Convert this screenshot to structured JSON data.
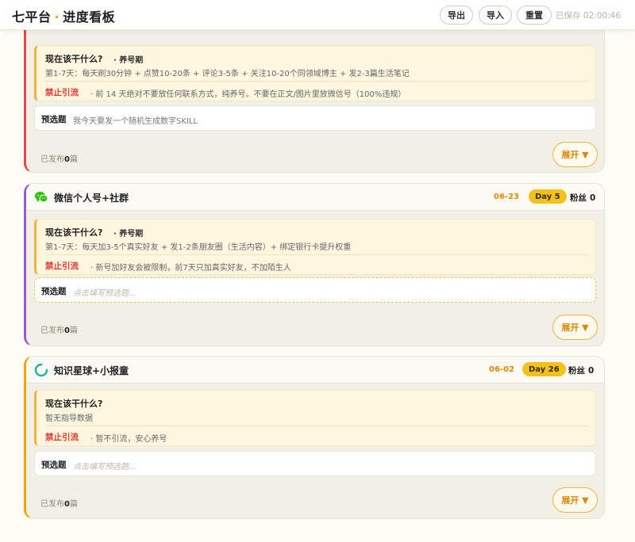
{
  "header": {
    "brand_left": "七平台",
    "brand_dot": "·",
    "brand_right": "进度看板",
    "export_label": "导出",
    "import_label": "导入",
    "reset_label": "重置",
    "saved_text": "已保存 02:00:46"
  },
  "cards": [
    {
      "accent": "#e8454f",
      "todo_question": "现在该干什么?",
      "phase": "· 养号期",
      "plan": "第1-7天：每天刷30分钟 + 点赞10-20条 + 评论3-5条 + 关注10-20个同领域博主 + 发2-3篇生活笔记",
      "ban_label": "禁止引流",
      "ban_text": "· 前 14 天绝对不要放任何联系方式，纯养号。不要在正文/图片里放微信号（100%违规）",
      "topic_label": "预选题",
      "topic_value": "我今天要发一个随机生成数字SKILL",
      "published_prefix": "已发布",
      "published_count": "0",
      "published_suffix": "篇",
      "expand_label": "展开 ▼"
    },
    {
      "accent": "#9b59d0",
      "platform_name": "微信个人号+社群",
      "platform_icon": "wechat-icon",
      "date": "06-23",
      "day": "Day 5",
      "fans_label": "粉丝",
      "fans_value": "0",
      "todo_question": "现在该干什么?",
      "phase": "· 养号期",
      "plan": "第1-7天：每天加3-5个真实好友 + 发1-2条朋友圈（生活内容）+ 绑定银行卡提升权重",
      "ban_label": "禁止引流",
      "ban_text": "· 新号加好友会被限制，前7天只加真实好友，不加陌生人",
      "topic_label": "预选题",
      "topic_placeholder": "点击填写预选题...",
      "published_prefix": "已发布",
      "published_count": "0",
      "published_suffix": "篇",
      "expand_label": "展开 ▼"
    },
    {
      "accent": "#f0a500",
      "platform_name": "知识星球+小报童",
      "platform_icon": "zsxq-icon",
      "date": "06-02",
      "day": "Day 26",
      "fans_label": "粉丝",
      "fans_value": "0",
      "todo_question": "现在该干什么?",
      "plan": "暂无指导数据",
      "ban_label": "禁止引流",
      "ban_text": "· 暂不引流，安心养号",
      "topic_label": "预选题",
      "topic_placeholder": "点击填写预选题...",
      "published_prefix": "已发布",
      "published_count": "0",
      "published_suffix": "篇",
      "expand_label": "展开 ▼"
    }
  ]
}
